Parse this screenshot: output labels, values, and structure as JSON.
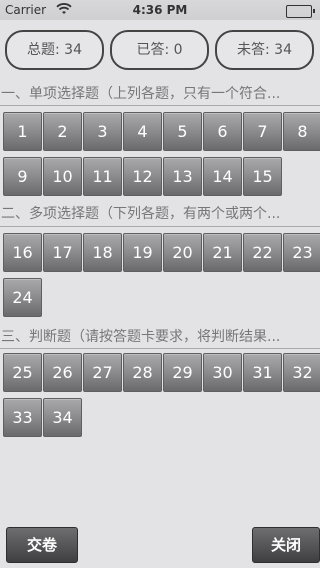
{
  "status_bar": {
    "carrier": "Carrier",
    "time": "4:36 PM",
    "wifi_icon": "wifi-icon",
    "battery_icon": "battery-icon"
  },
  "summary": {
    "total": "总题: 34",
    "answered": "已答: 0",
    "unanswered": "未答: 34"
  },
  "sections": [
    {
      "title": "一、单项选择题（上列各题，只有一个符合..."
    },
    {
      "title": "二、多项选择题（下列各题，有两个或两个..."
    },
    {
      "title": "三、判断题（请按答题卡要求，将判断结果..."
    }
  ],
  "questions": {
    "single": [
      "1",
      "2",
      "3",
      "4",
      "5",
      "6",
      "7",
      "8",
      "9",
      "10",
      "11",
      "12",
      "13",
      "14",
      "15"
    ],
    "multiple": [
      "16",
      "17",
      "18",
      "19",
      "20",
      "21",
      "22",
      "23",
      "24"
    ],
    "judge": [
      "25",
      "26",
      "27",
      "28",
      "29",
      "30",
      "31",
      "32",
      "33",
      "34"
    ]
  },
  "buttons": {
    "submit": "交卷",
    "close": "关闭"
  }
}
